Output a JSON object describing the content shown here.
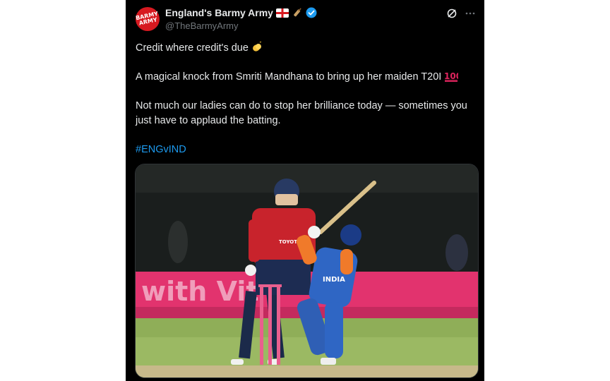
{
  "tweet": {
    "display_name": "England's Barmy Army",
    "handle": "@TheBarmyArmy",
    "avatar_text": "BARMY ARMY",
    "line1": "Credit where credit's due",
    "line2": "A magical knock from Smriti Mandhana to bring up her maiden T20I",
    "line3": "Not much our ladies can do to stop her brilliance today — sometimes you just have to applaud the batting.",
    "hashtag": "#ENGvIND",
    "emojis": [
      "england-flag",
      "cricket-bat",
      "verified-badge",
      "clapping-hands",
      "hundred-points"
    ]
  },
  "photo": {
    "banner_text": "with Vit",
    "bowler_sponsor": "TOYOTA",
    "batter_shirt_text": "INDIA"
  },
  "colors": {
    "tweet_bg": "#000000",
    "text": "#e7e9ea",
    "secondary_text": "#71767b",
    "link": "#1d9bf0",
    "avatar_red": "#d71920"
  }
}
